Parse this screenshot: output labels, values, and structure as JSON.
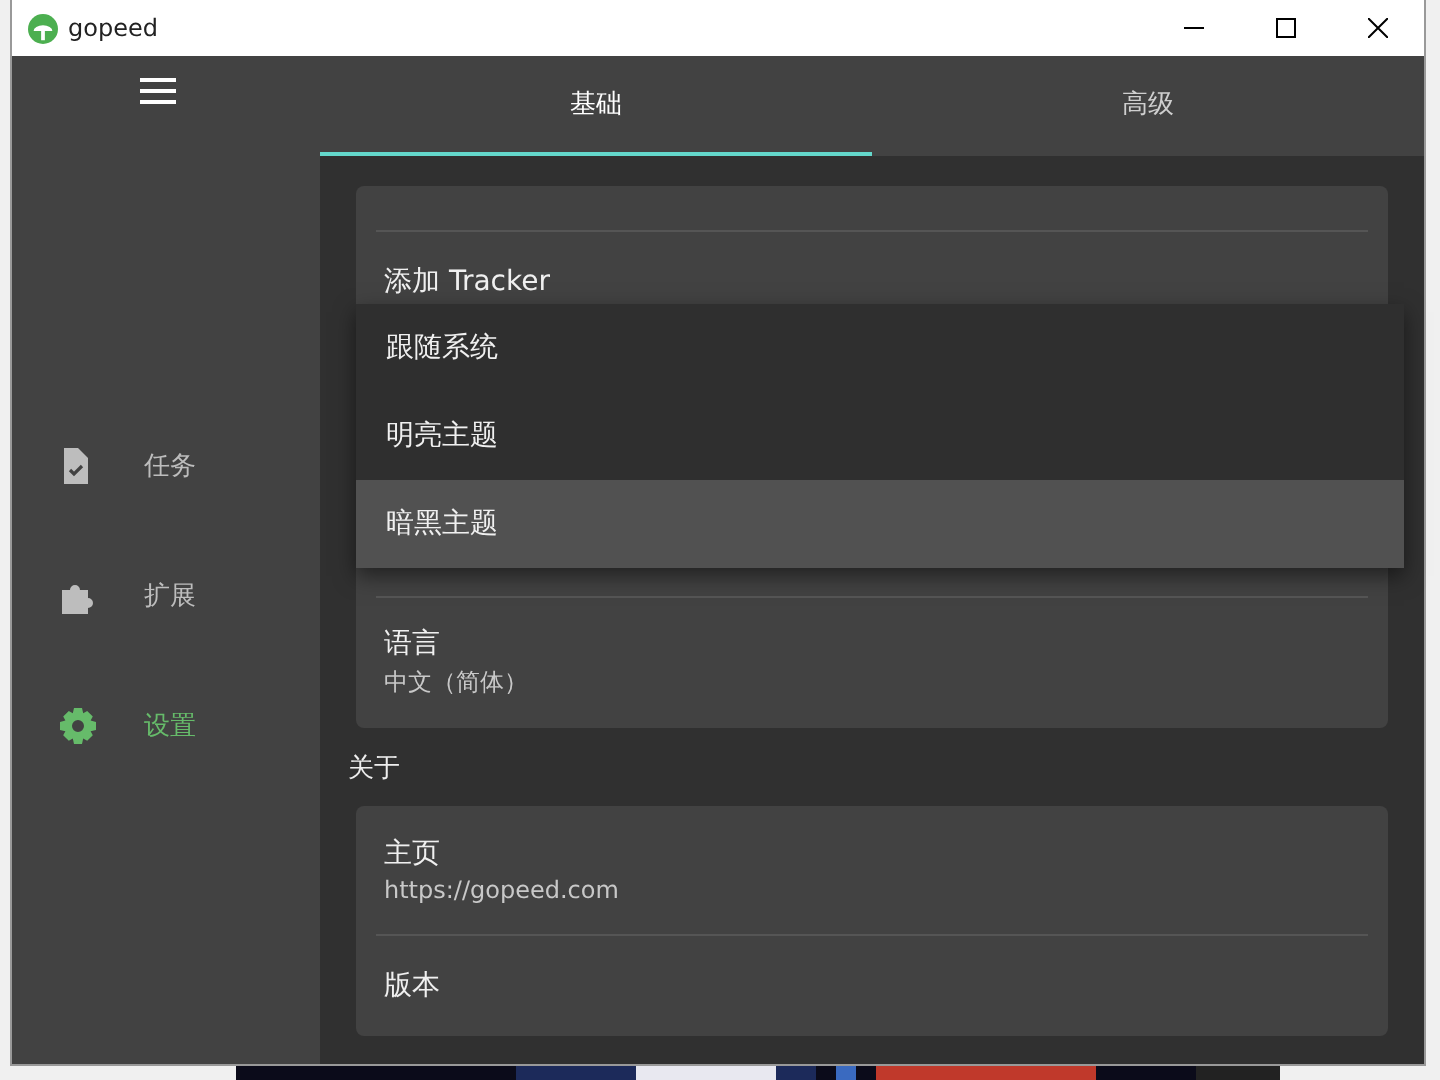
{
  "window": {
    "title": "gopeed"
  },
  "sidebar": {
    "items": [
      {
        "label": "任务",
        "selected": false
      },
      {
        "label": "扩展",
        "selected": false
      },
      {
        "label": "设置",
        "selected": true
      }
    ]
  },
  "tabs": [
    {
      "label": "基础",
      "selected": true
    },
    {
      "label": "高级",
      "selected": false
    }
  ],
  "cards": [
    {
      "rows": [
        {
          "title": "添加 Tracker"
        }
      ]
    },
    {
      "rows": [
        {
          "title": "语言",
          "subtitle": "中文（简体）"
        }
      ]
    },
    {
      "title": "关于",
      "rows": [
        {
          "title": "主页",
          "subtitle": "https://gopeed.com"
        },
        {
          "title": "版本"
        }
      ]
    }
  ],
  "theme_menu": {
    "items": [
      {
        "label": "跟随系统",
        "selected": false
      },
      {
        "label": "明亮主题",
        "selected": false
      },
      {
        "label": "暗黑主题",
        "selected": true
      }
    ]
  }
}
